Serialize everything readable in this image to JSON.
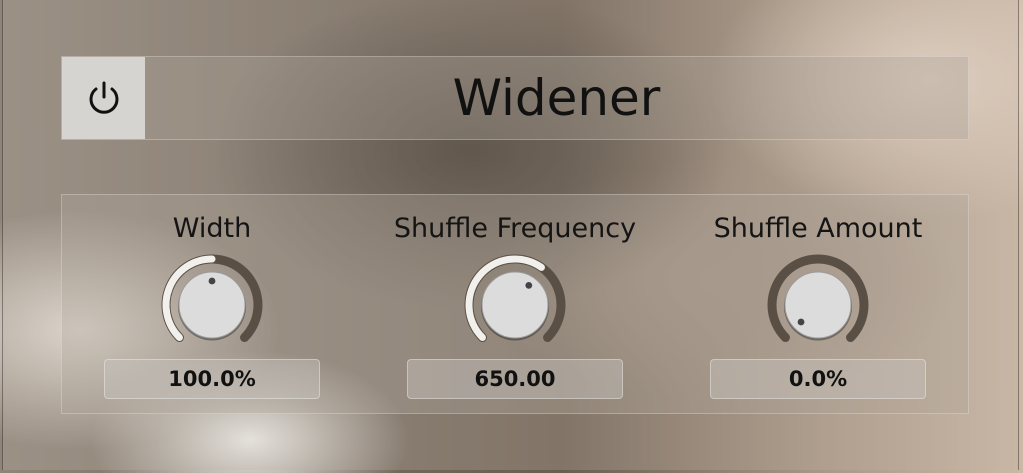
{
  "plugin": {
    "title": "Widener",
    "power_icon": "power-icon"
  },
  "controls": [
    {
      "label": "Width",
      "value": "100.0%",
      "level": 0.5
    },
    {
      "label": "Shuffle Frequency",
      "value": "650.00",
      "level": 0.63
    },
    {
      "label": "Shuffle Amount",
      "value": "0.0%",
      "level": 0.0
    }
  ],
  "colors": {
    "knob_track": "#5a4f45",
    "knob_fill": "#f2f0ec",
    "knob_body": "#dcdcdc",
    "power_button_bg": "#d6d4d1"
  }
}
